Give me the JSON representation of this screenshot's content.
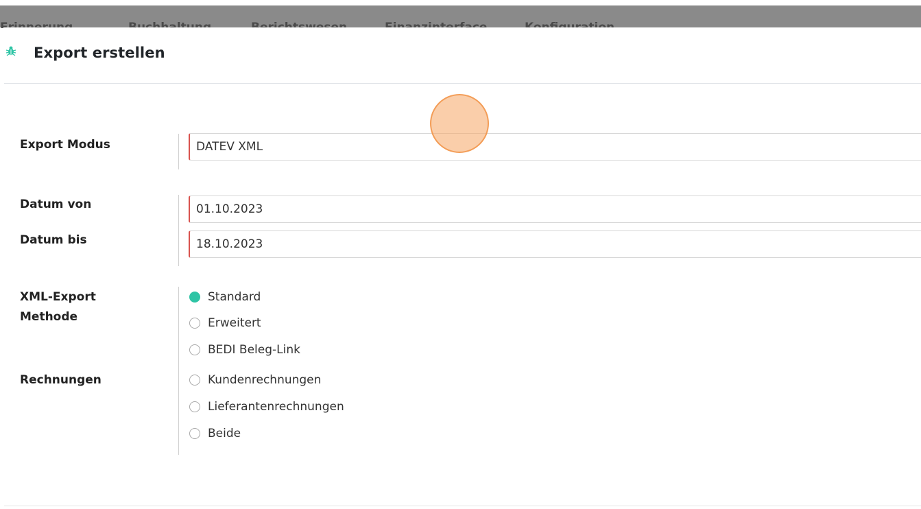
{
  "top_menu": {
    "items": [
      "Erinnerung",
      "Buchhaltung",
      "Berichtswesen",
      "Finanzinterface",
      "Konfiguration"
    ]
  },
  "modal": {
    "title": "Export erstellen",
    "icon": "bug-icon",
    "accent_color": "#2ec4a5",
    "required_border_color": "#d9534f"
  },
  "form": {
    "export_mode": {
      "label": "Export Modus",
      "value": "DATEV XML"
    },
    "date_from": {
      "label": "Datum von",
      "value": "01.10.2023"
    },
    "date_to": {
      "label": "Datum bis",
      "value": "18.10.2023"
    },
    "xml_method": {
      "label_line1": "XML-Export",
      "label_line2": "Methode",
      "options": [
        {
          "label": "Standard",
          "checked": true
        },
        {
          "label": "Erweitert",
          "checked": false
        },
        {
          "label": "BEDI Beleg-Link",
          "checked": false
        }
      ]
    },
    "invoices": {
      "label": "Rechnungen",
      "options": [
        {
          "label": "Kundenrechnungen",
          "checked": false
        },
        {
          "label": "Lieferantenrechnungen",
          "checked": false
        },
        {
          "label": "Beide",
          "checked": false
        }
      ]
    }
  }
}
